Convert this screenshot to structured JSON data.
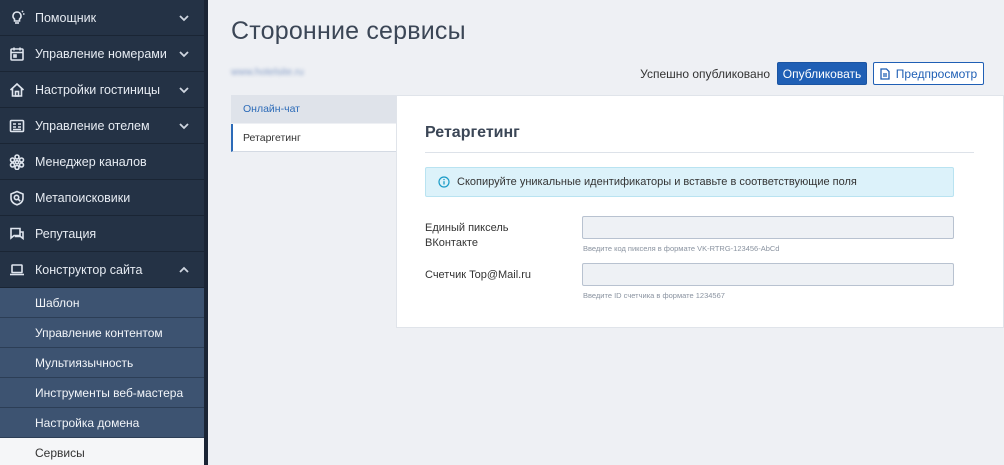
{
  "sidebar": {
    "items": [
      {
        "label": "Помощник",
        "icon": "lightbulb-icon",
        "chevron": "down"
      },
      {
        "label": "Управление номерами",
        "icon": "calendar-icon",
        "chevron": "down"
      },
      {
        "label": "Настройки гостиницы",
        "icon": "house-icon",
        "chevron": "down"
      },
      {
        "label": "Управление отелем",
        "icon": "dashboard-icon",
        "chevron": "down"
      },
      {
        "label": "Менеджер каналов",
        "icon": "hexagon-network-icon",
        "chevron": ""
      },
      {
        "label": "Метапоисковики",
        "icon": "search-shield-icon",
        "chevron": ""
      },
      {
        "label": "Репутация",
        "icon": "chat-icon",
        "chevron": ""
      },
      {
        "label": "Конструктор сайта",
        "icon": "laptop-icon",
        "chevron": "up"
      }
    ],
    "subitems": [
      {
        "label": "Шаблон"
      },
      {
        "label": "Управление контентом"
      },
      {
        "label": "Мультиязычность"
      },
      {
        "label": "Инструменты веб-мастера"
      },
      {
        "label": "Настройка домена"
      },
      {
        "label": "Сервисы",
        "active": true
      }
    ]
  },
  "main": {
    "title": "Сторонние сервисы",
    "site_url": "www.hotelsite.ru",
    "status": "Успешно опубликовано",
    "publish_label": "Опубликовать",
    "preview_label": "Предпросмотр"
  },
  "tabs": [
    {
      "label": "Онлайн-чат"
    },
    {
      "label": "Ретаргетинг",
      "active": true
    }
  ],
  "panel": {
    "title": "Ретаргетинг",
    "info": "Скопируйте уникальные идентификаторы и вставьте в соответствующие поля",
    "fields": [
      {
        "label": "Единый пиксель ВКонтакте",
        "value": "",
        "hint": "Введите код пикселя в формате VK-RTRG-123456-AbCd"
      },
      {
        "label": "Счетчик Top@Mail.ru",
        "value": "",
        "hint": "Введите ID счетчика в формате 1234567"
      }
    ]
  },
  "colors": {
    "sidebar_bg": "#243245",
    "submenu_bg": "#3d5371",
    "accent": "#1f5fb5",
    "info_bg": "#dcf2fa"
  }
}
